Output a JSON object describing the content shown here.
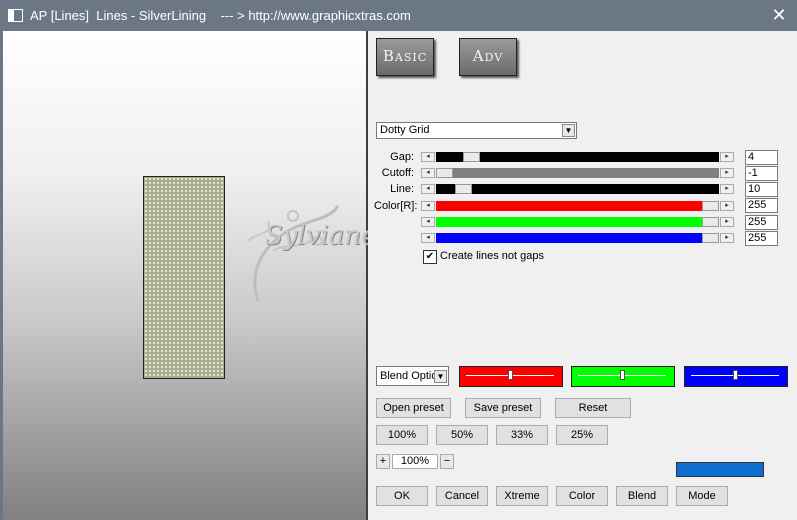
{
  "window": {
    "title": "AP [Lines]  Lines - SilverLining    --- > http://www.graphicxtras.com",
    "close_glyph": "✕"
  },
  "preview": {
    "watermark_text": "Sylviane",
    "swatch_color": "#a7ac8c"
  },
  "tabs": {
    "basic": "Basic",
    "adv": "Adv"
  },
  "pattern_select": {
    "value": "Dotty Grid"
  },
  "sliders": [
    {
      "label": "Gap:",
      "value": "4",
      "fill": 0.1,
      "color": "#000000"
    },
    {
      "label": "Cutoff:",
      "value": "-1",
      "fill": 0.0,
      "color": "#808080"
    },
    {
      "label": "Line:",
      "value": "10",
      "fill": 0.07,
      "color": "#000000"
    },
    {
      "label": "Color[R]:",
      "value": "255",
      "fill": 1.0,
      "color": "#ff0000"
    },
    {
      "label": "",
      "value": "255",
      "fill": 1.0,
      "color": "#00ff00"
    },
    {
      "label": "",
      "value": "255",
      "fill": 1.0,
      "color": "#0000ff"
    }
  ],
  "checkbox": {
    "label": "Create lines not gaps",
    "checked": true,
    "check_glyph": "✔"
  },
  "blend_select": {
    "value": "Blend Optio"
  },
  "color_boxes": [
    {
      "color": "#ff0000",
      "level": 0.5
    },
    {
      "color": "#00ff00",
      "level": 0.5
    },
    {
      "color": "#0000ff",
      "level": 0.5
    }
  ],
  "preset_buttons": {
    "open": "Open preset",
    "save": "Save preset",
    "reset": "Reset"
  },
  "zoom_buttons": [
    "100%",
    "50%",
    "33%",
    "25%"
  ],
  "zoom": {
    "plus": "+",
    "value": "100%",
    "minus": "−"
  },
  "accent_color": "#0e6fd3",
  "bottom_buttons": [
    "OK",
    "Cancel",
    "Xtreme",
    "Color",
    "Blend",
    "Mode"
  ]
}
